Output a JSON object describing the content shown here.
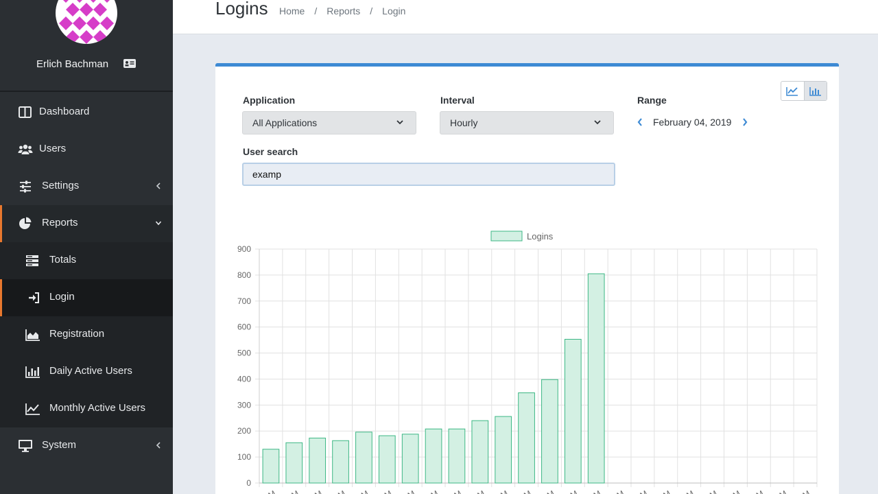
{
  "user": {
    "name": "Erlich Bachman"
  },
  "sidebar": {
    "items": [
      {
        "label": "Dashboard",
        "icon": "columns-icon"
      },
      {
        "label": "Users",
        "icon": "users-icon"
      },
      {
        "label": "Settings",
        "icon": "sliders-icon"
      },
      {
        "label": "Reports",
        "icon": "pie-chart-icon"
      },
      {
        "label": "Totals",
        "icon": "server-icon"
      },
      {
        "label": "Login",
        "icon": "sign-in-icon"
      },
      {
        "label": "Registration",
        "icon": "area-chart-icon"
      },
      {
        "label": "Daily Active Users",
        "icon": "bar-chart-icon"
      },
      {
        "label": "Monthly Active Users",
        "icon": "line-chart-icon"
      },
      {
        "label": "System",
        "icon": "desktop-icon"
      }
    ]
  },
  "header": {
    "title": "Logins",
    "breadcrumbs": [
      "Home",
      "Reports",
      "Login"
    ],
    "separator": "/"
  },
  "filters": {
    "application_label": "Application",
    "application_value": "All Applications",
    "interval_label": "Interval",
    "interval_value": "Hourly",
    "range_label": "Range",
    "range_value": "February 04, 2019",
    "search_label": "User search",
    "search_value": "examp"
  },
  "colors": {
    "accent": "#3d8ad4",
    "active_marker": "#e8782e",
    "bar_fill": "#d3f0e3",
    "bar_stroke": "#3cb784"
  },
  "chart_data": {
    "type": "bar",
    "legend": [
      "Logins"
    ],
    "legend_position": "top",
    "grid": true,
    "ylim": [
      0,
      900
    ],
    "yticks": [
      0,
      100,
      200,
      300,
      400,
      500,
      600,
      700,
      800,
      900
    ],
    "categories": [
      "AM",
      "AM",
      "AM",
      "AM",
      "AM",
      "AM",
      "AM",
      "AM",
      "AM",
      "AM",
      "AM",
      "AM",
      "PM",
      "PM",
      "PM",
      "PM",
      "PM",
      "PM",
      "PM",
      "PM",
      "PM",
      "PM",
      "PM",
      "PM"
    ],
    "series": [
      {
        "name": "Logins",
        "values": [
          130,
          155,
          173,
          163,
          196,
          182,
          188,
          208,
          208,
          240,
          256,
          347,
          398,
          553,
          805,
          0,
          0,
          0,
          0,
          0,
          0,
          0,
          0,
          0
        ]
      }
    ]
  }
}
